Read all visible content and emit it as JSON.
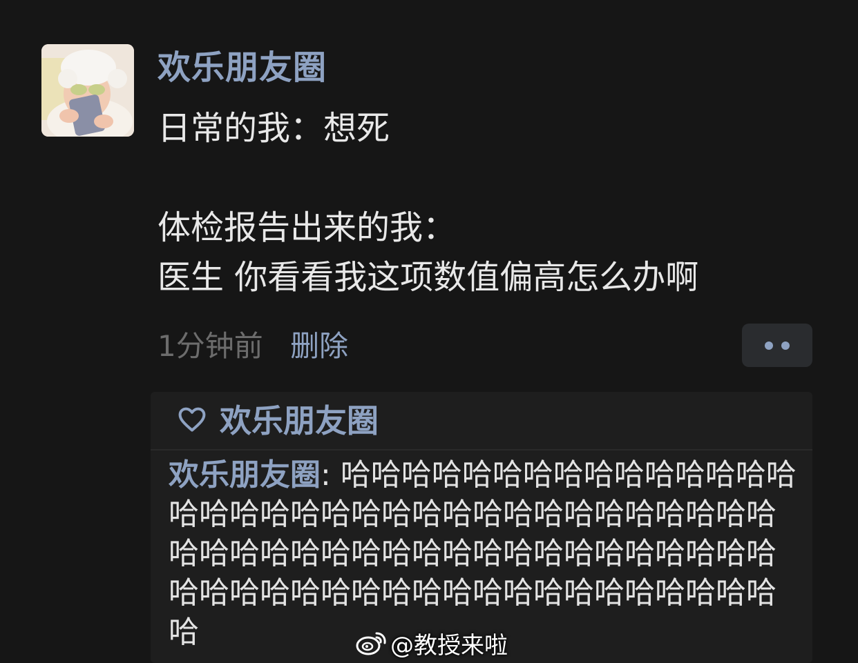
{
  "post": {
    "author": "欢乐朋友圈",
    "lines": [
      "日常的我：想死",
      "",
      "体检报告出来的我：",
      "医生 你看看我这项数值偏高怎么办啊"
    ],
    "time": "1分钟前",
    "delete_label": "删除"
  },
  "interactions": {
    "likes": "欢乐朋友圈",
    "comment": {
      "author": "欢乐朋友圈",
      "separator": ": ",
      "text": "哈哈哈哈哈哈哈哈哈哈哈哈哈哈哈哈哈哈哈哈哈哈哈哈哈哈哈哈哈哈哈哈哈哈哈哈哈哈哈哈哈哈哈哈哈哈哈哈哈哈哈哈哈哈哈哈哈哈哈哈哈哈哈哈哈哈哈哈哈哈哈哈哈哈哈哈"
    }
  },
  "watermark": {
    "text": "@教授来啦",
    "icon": "weibo-icon"
  },
  "colors": {
    "background": "#161616",
    "link": "#8ea2c2",
    "text": "#e8e8e8",
    "muted": "#6c6c6c",
    "panel": "#1e1e1e"
  }
}
